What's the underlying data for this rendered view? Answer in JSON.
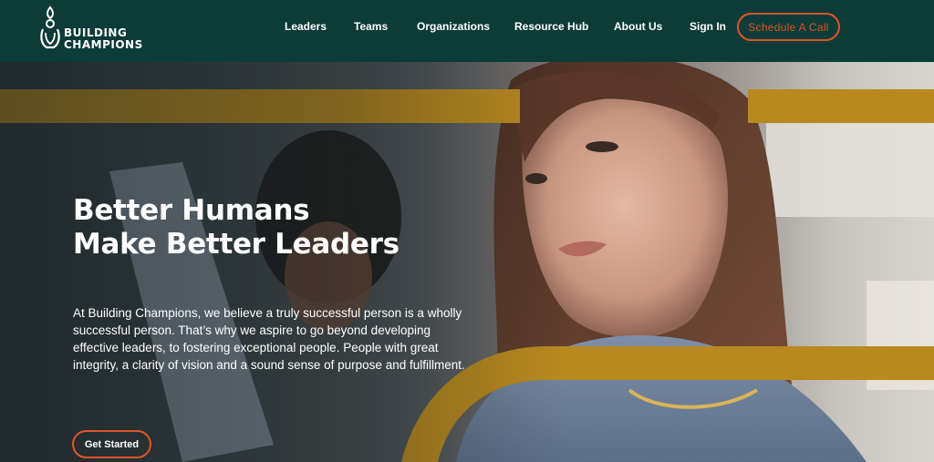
{
  "brand": {
    "name_line1": "BUILDING",
    "name_line2": "CHAMPIONS",
    "colors": {
      "header_bg": "#0d3b37",
      "accent_orange": "#e0542a",
      "band_gold": "#b8891f"
    }
  },
  "nav": {
    "items": [
      {
        "label": "Leaders"
      },
      {
        "label": "Teams"
      },
      {
        "label": "Organizations"
      },
      {
        "label": "Resource Hub"
      },
      {
        "label": "About Us"
      },
      {
        "label": "Sign In"
      }
    ],
    "cta_label": "Schedule A Call"
  },
  "hero": {
    "title_line1": "Better Humans",
    "title_line2": "Make Better Leaders",
    "body": "At Building Champions, we believe a truly successful person is a wholly successful person. That’s why we aspire to go beyond developing effective leaders, to fostering exceptional people. People with great integrity, a clarity of vision and a sound sense of purpose and fulfillment.",
    "button_label": "Get Started"
  }
}
